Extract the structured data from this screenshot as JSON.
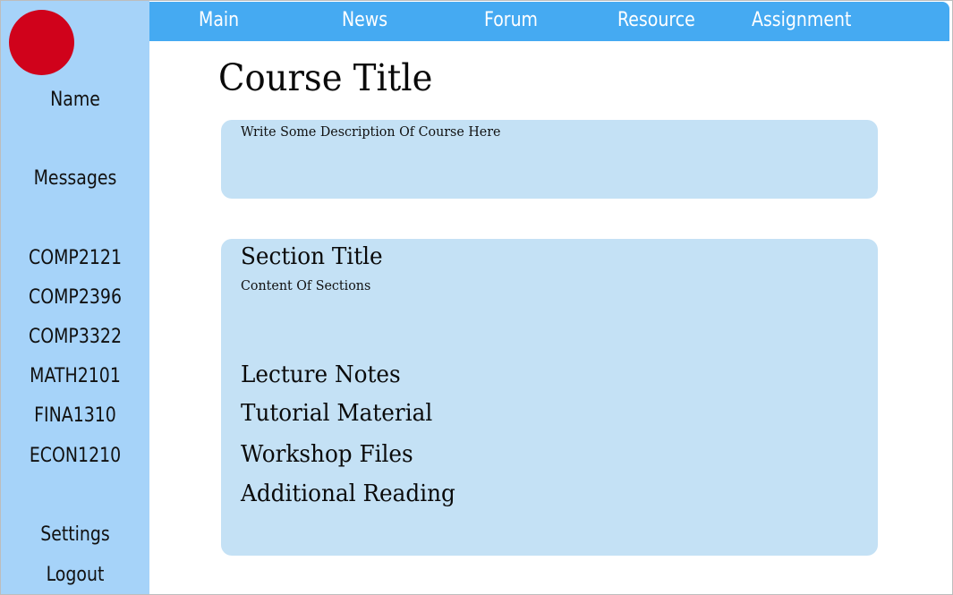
{
  "sidebar": {
    "avatar_color": "#d0021b",
    "name_label": "Name",
    "messages_label": "Messages",
    "courses": [
      "COMP2121",
      "COMP2396",
      "COMP3322",
      "MATH2101",
      "FINA1310",
      "ECON1210"
    ],
    "settings_label": "Settings",
    "logout_label": "Logout"
  },
  "topnav": {
    "items": [
      "Main",
      "News",
      "Forum",
      "Resource",
      "Assignment"
    ]
  },
  "main": {
    "course_title": "Course Title",
    "description": "Write Some Description Of Course Here",
    "section": {
      "title": "Section Title",
      "content": "Content Of Sections",
      "links": [
        "Lecture Notes",
        "Tutorial Material",
        "Workshop Files",
        "Additional Reading"
      ]
    }
  },
  "colors": {
    "sidebar_bg": "#a6d3f9",
    "topnav_bg": "#45aaf2",
    "panel_bg": "#c4e1f5"
  }
}
